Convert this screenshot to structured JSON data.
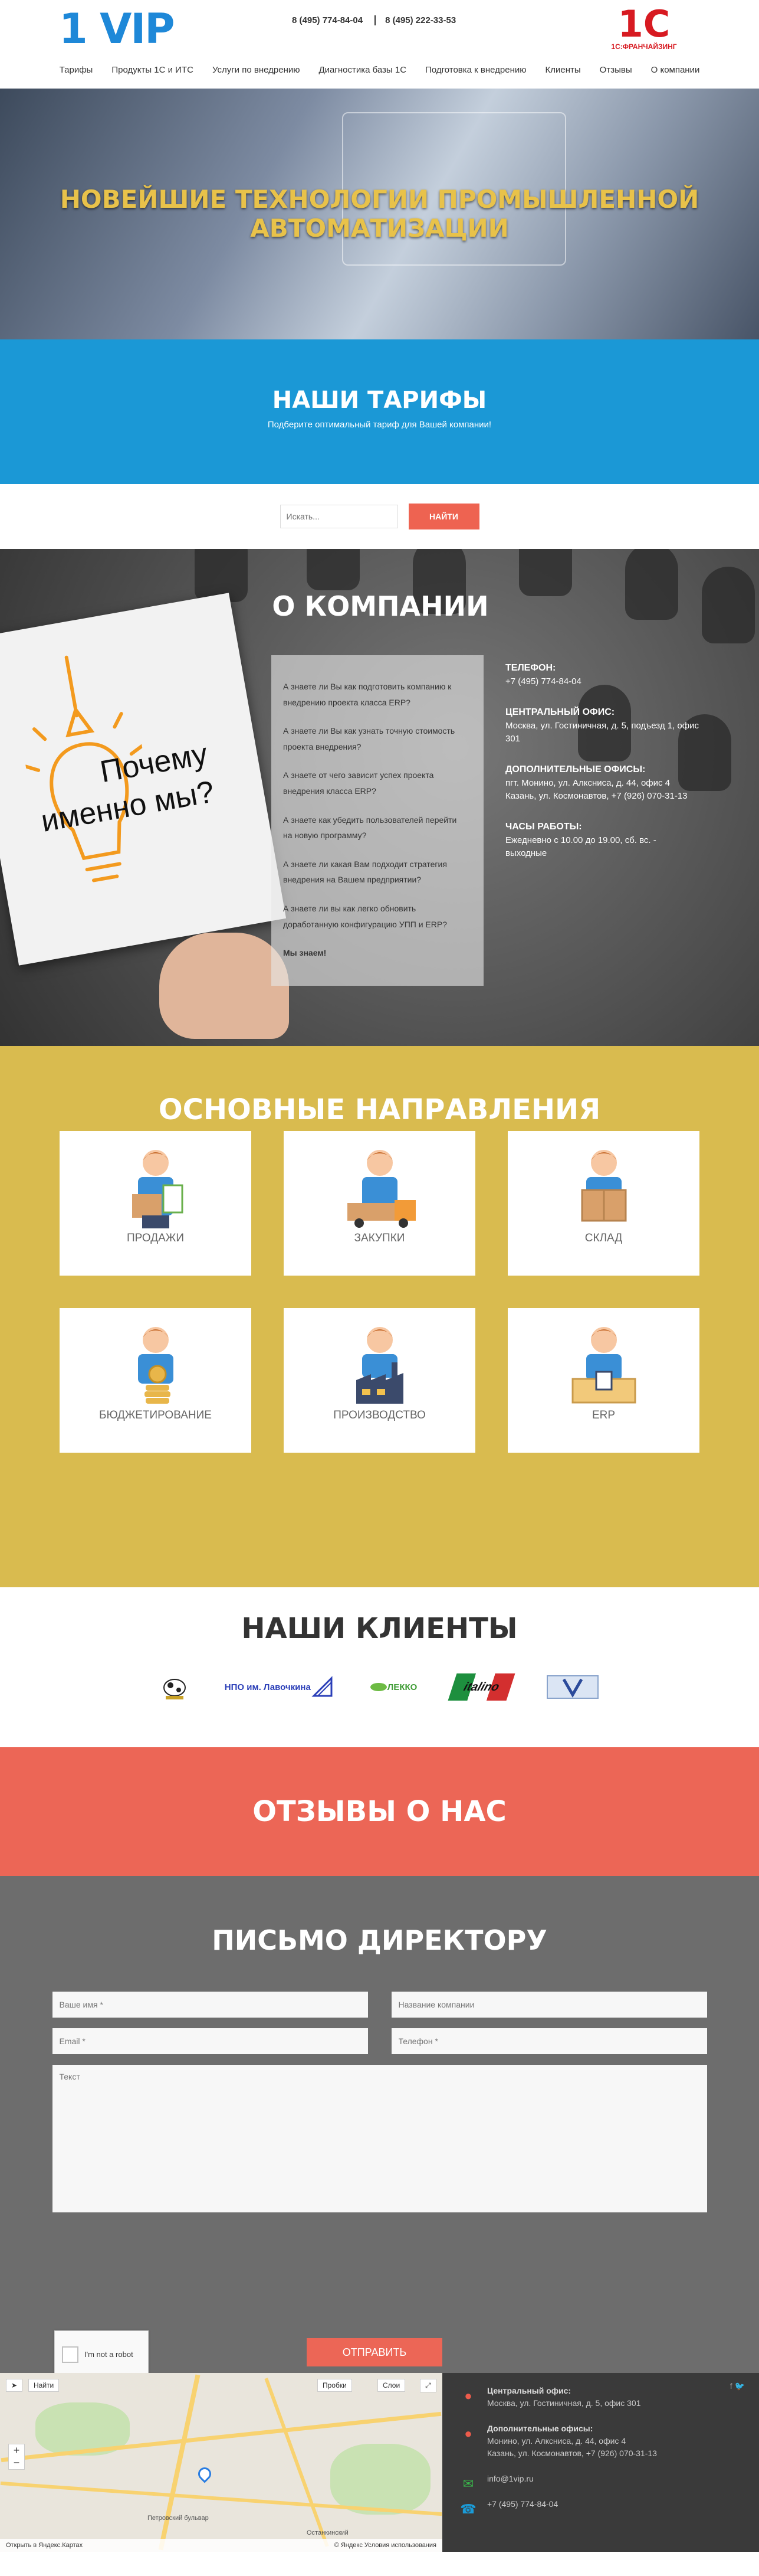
{
  "header": {
    "logo": "1 VIP",
    "phones": [
      "8 (495) 774-84-04",
      "8 (495) 222-33-53"
    ],
    "brand_logo": "1С",
    "brand_text": "1С:ФРАНЧАЙЗИНГ",
    "nav": [
      "Тарифы",
      "Продукты 1С и ИТС",
      "Услуги по внедрению",
      "Диагностика базы 1С",
      "Подготовка к внедрению",
      "Клиенты",
      "Отзывы",
      "О компании"
    ]
  },
  "hero": {
    "title_line1": "НОВЕЙШИЕ ТЕХНОЛОГИИ ПРОМЫШЛЕННОЙ",
    "title_line2": "АВТОМАТИЗАЦИИ"
  },
  "tariffs": {
    "title": "НАШИ ТАРИФЫ",
    "subtitle": "Подберите оптимальный тариф для Вашей компании!"
  },
  "search": {
    "placeholder": "Искать...",
    "button": "НАЙТИ"
  },
  "about": {
    "title": "О КОМПАНИИ",
    "why_line1": "Почему",
    "why_line2": "именно мы?",
    "questions": [
      "А знаете ли Вы как подготовить компанию к внедрению проекта класса ERP?",
      "А знаете ли Вы как узнать точную стоимость проекта внедрения?",
      "А знаете от чего зависит успех проекта внедрения класса ERP?",
      "А знаете как убедить пользователей перейти на новую программу?",
      "А знаете ли какая Вам подходит стратегия внедрения на Вашем предприятии?",
      "А знаете ли вы как легко обновить доработанную конфигурацию УПП и ERP?"
    ],
    "answer": "Мы знаем!",
    "contacts": {
      "phone_title": "ТЕЛЕФОН:",
      "phone": "+7 (495) 774-84-04",
      "office_title": "ЦЕНТРАЛЬНЫЙ ОФИС:",
      "office": "Москва, ул. Гостиничная, д. 5, подъезд 1, офис 301",
      "extra_title": "ДОПОЛНИТЕЛЬНЫЕ ОФИСЫ:",
      "extra1": "пгт. Монино, ул. Алксниса, д. 44, офис 4",
      "extra2": "Казань, ул. Космонавтов, +7 (926) 070-31-13",
      "hours_title": "ЧАСЫ РАБОТЫ:",
      "hours": "Ежедневно с 10.00 до 19.00, сб. вс. - выходные"
    }
  },
  "directions": {
    "title": "ОСНОВНЫЕ НАПРАВЛЕНИЯ",
    "items": [
      "ПРОДАЖИ",
      "ЗАКУПКИ",
      "СКЛАД",
      "БЮДЖЕТИРОВАНИЕ",
      "ПРОИЗВОДСТВО",
      "ERP"
    ]
  },
  "clients": {
    "title": "НАШИ КЛИЕНТЫ",
    "logos": [
      "НПО им. Лавочкина",
      "ЛЕККО",
      "italino"
    ]
  },
  "reviews": {
    "title": "ОТЗЫВЫ О НАС"
  },
  "letter": {
    "title": "ПИСЬМО ДИРЕКТОРУ",
    "name_ph": "Ваше имя *",
    "company_ph": "Название компании",
    "email_ph": "Email *",
    "phone_ph": "Телефон *",
    "text_ph": "Текст",
    "captcha": "I'm not a robot",
    "send": "ОТПРАВИТЬ"
  },
  "map": {
    "find": "Найти",
    "traffic": "Пробки",
    "layers": "Слои",
    "open_yandex": "Открыть в Яндекс.Картах",
    "terms": "© Яндекс Условия использования",
    "labels": [
      "Петровский бульвар",
      "Останкинский"
    ]
  },
  "footer": {
    "office_title": "Центральный офис:",
    "office": "Москва, ул. Гостиничная, д. 5, офис 301",
    "extra_title": "Дополнительные офисы:",
    "extra1": "Монино, ул. Алксниса, д. 44, офис 4",
    "extra2": "Казань, ул. Космонавтов, +7 (926) 070-31-13",
    "email": "info@1vip.ru",
    "phone": "+7 (495) 774-84-04"
  },
  "colors": {
    "blue": "#1b98d6",
    "coral": "#ec6656",
    "mustard": "#d9bb4f",
    "gray": "#6d6d6d"
  }
}
